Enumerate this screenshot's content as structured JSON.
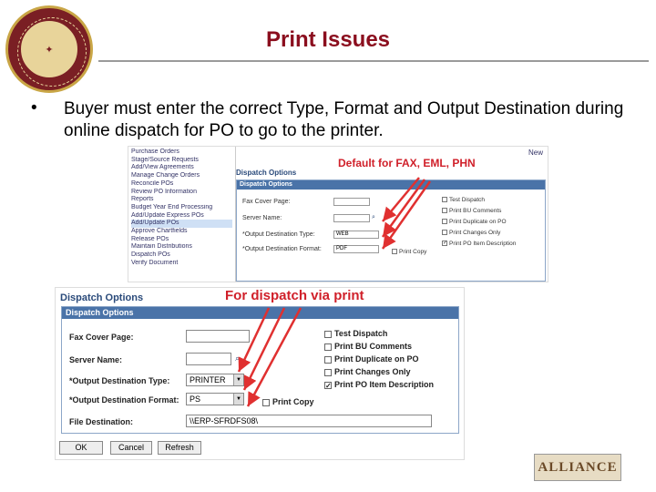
{
  "slide": {
    "title": "Print Issues",
    "bullet": "Buyer must enter the correct Type, Format and Output Destination during online dispatch for PO to go to the printer."
  },
  "seal": {
    "text": "FLORIDA STATE UNIVERSITY 1851"
  },
  "screenshot_top": {
    "new_link": "New",
    "menu_items": [
      "Purchase Orders",
      "Stage/Source Requests",
      "Add/View Agreements",
      "Manage Change Orders",
      "Reconcile POs",
      "Review PO Information",
      "Reports",
      "Budget Year End Processing",
      "Add/Update Express POs",
      "Add/Update POs",
      "Approve Chartfields",
      "Release POs",
      "Maintain Distributions",
      "Dispatch POs",
      "Verify Document"
    ],
    "panel_label": "Dispatch Options",
    "panel_header": "Dispatch Options",
    "fax_cover_label": "Fax Cover Page:",
    "server_name_label": "Server Name:",
    "out_type_label": "*Output Destination Type:",
    "out_type_value": "WEB",
    "out_format_label": "*Output Destination Format:",
    "out_format_value": "PDF",
    "print_copy": "Print Copy",
    "checkboxes": [
      "Test Dispatch",
      "Print BU Comments",
      "Print Duplicate on PO",
      "Print Changes Only",
      "Print PO Item Description"
    ],
    "annotation": "Default for FAX, EML, PHN"
  },
  "screenshot_bottom": {
    "panel_label": "Dispatch Options",
    "panel_header": "Dispatch Options",
    "fax_cover_label": "Fax Cover Page:",
    "server_name_label": "Server Name:",
    "out_type_label": "*Output Destination Type:",
    "out_type_value": "PRINTER",
    "out_format_label": "*Output Destination Format:",
    "out_format_value": "PS",
    "file_dest_label": "File Destination:",
    "file_dest_value": "\\\\ERP-SFRDFS08\\",
    "print_copy": "Print Copy",
    "checkboxes": [
      "Test Dispatch",
      "Print BU Comments",
      "Print Duplicate on PO",
      "Print Changes Only",
      "Print PO Item Description"
    ],
    "annotation": "For dispatch via print",
    "buttons": {
      "ok": "OK",
      "cancel": "Cancel",
      "refresh": "Refresh"
    }
  },
  "logo": {
    "text": "ALLIANCE"
  },
  "colors": {
    "title": "#8b0e1e",
    "annotation": "#d0202a",
    "panel_header": "#4a73a8",
    "arrow": "#e03030"
  }
}
